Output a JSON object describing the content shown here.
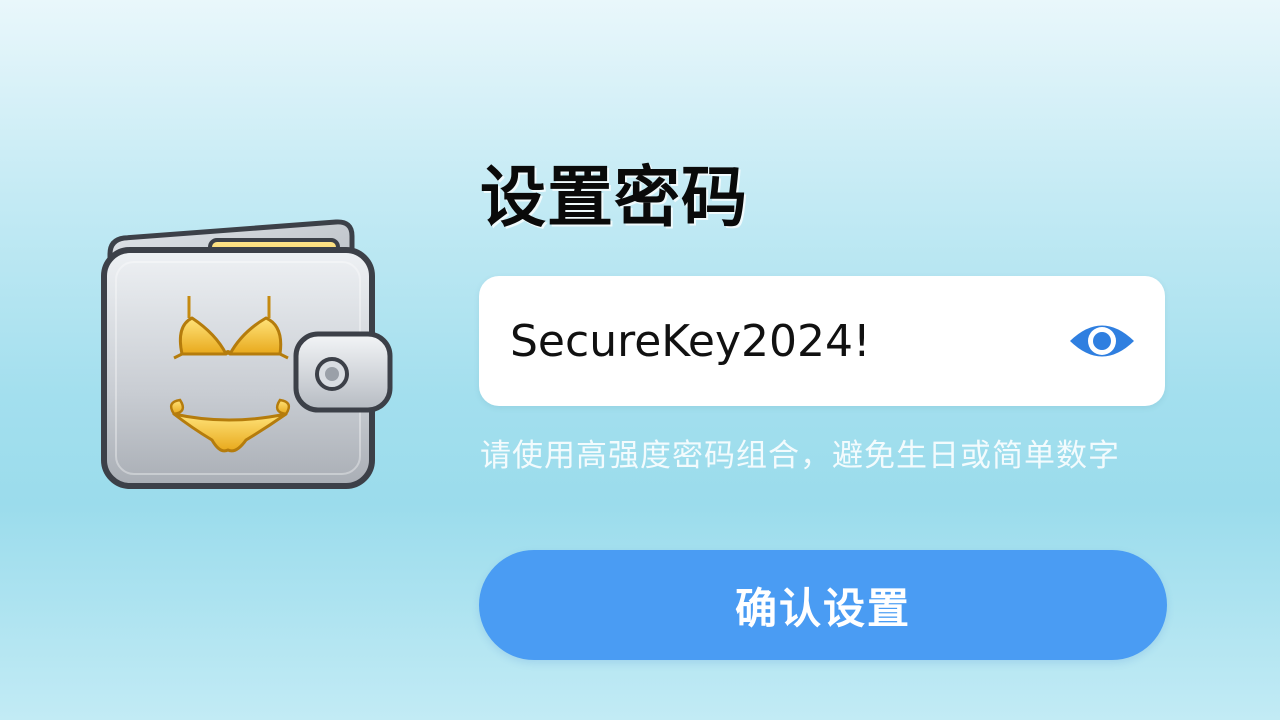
{
  "illustration": {
    "name": "wallet-with-bikini-icon"
  },
  "form": {
    "title": "设置密码",
    "password_value": "SecureKey2024!",
    "visibility_icon": "eye-icon",
    "hint": "请使用高强度密码组合，避免生日或简单数字",
    "confirm_label": "确认设置"
  },
  "colors": {
    "accent": "#4a9cf3",
    "eye_icon": "#2f7fe0"
  }
}
